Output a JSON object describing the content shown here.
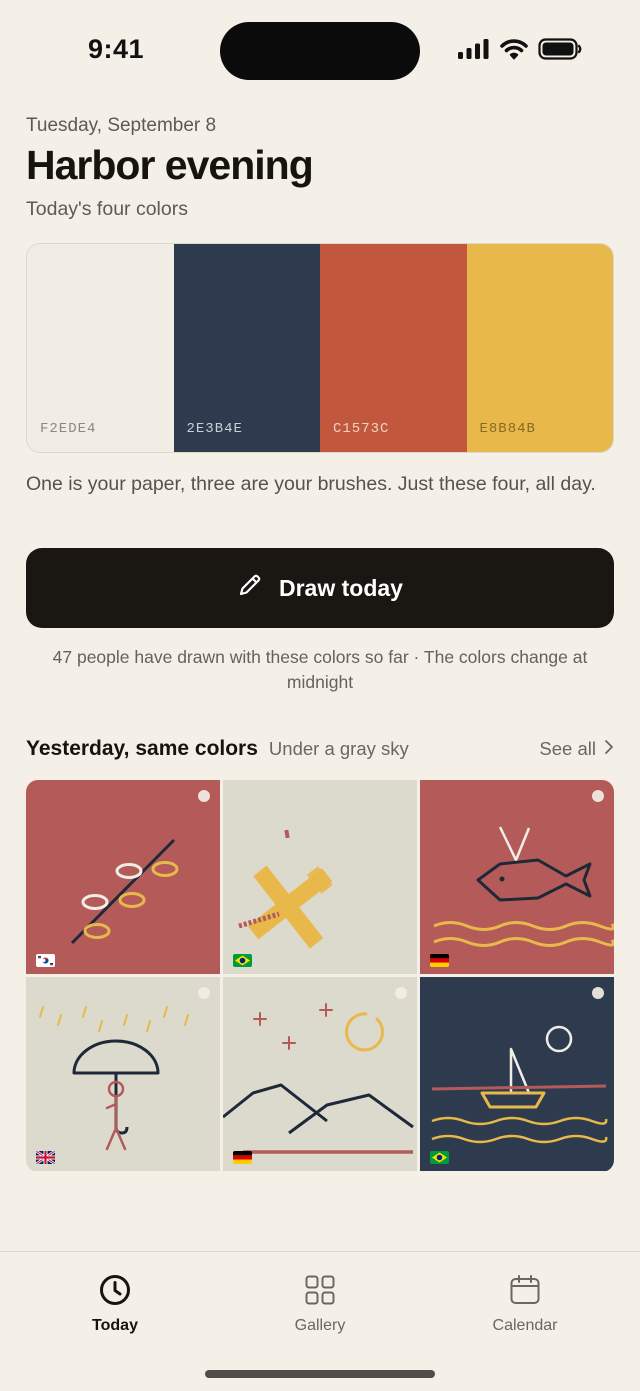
{
  "status": {
    "time": "9:41"
  },
  "header": {
    "date": "Tuesday, September 8",
    "title": "Harbor evening",
    "subtitle": "Today's four colors"
  },
  "palette": [
    {
      "hex": "F2EDE4",
      "color": "#F2EDE4",
      "text_color": "#8d887e"
    },
    {
      "hex": "2E3B4E",
      "color": "#2E3B4E",
      "text_color": "#c9cfd8"
    },
    {
      "hex": "C1573C",
      "color": "#C1573C",
      "text_color": "#f0d2c7"
    },
    {
      "hex": "E8B84B",
      "color": "#E8B84B",
      "text_color": "#8a6a20"
    }
  ],
  "blurb": "One is your paper, three are your brushes. Just these four, all day.",
  "draw_button": {
    "label": "Draw today",
    "icon": "pencil-icon"
  },
  "count_note": "47 people have drawn with these colors so far · The colors change at midnight",
  "yesterday": {
    "title": "Yesterday, same colors",
    "subtitle": "Under a gray sky",
    "see_all": "See all",
    "drawings": [
      {
        "subject": "rings-on-a-line",
        "flag": "south-korea",
        "background": "#B45B5A"
      },
      {
        "subject": "yellow-airplane",
        "flag": "brazil",
        "background": "#DCDACD"
      },
      {
        "subject": "whale",
        "flag": "germany",
        "background": "#B45B5A"
      },
      {
        "subject": "person-with-umbrella",
        "flag": "united-kingdom",
        "background": "#DCDACD"
      },
      {
        "subject": "hills-and-stars",
        "flag": "germany",
        "background": "#DCDACD"
      },
      {
        "subject": "sailboat",
        "flag": "brazil",
        "background": "#2E3B4E"
      }
    ]
  },
  "tabs": [
    {
      "label": "Today",
      "icon": "clock-icon",
      "active": true
    },
    {
      "label": "Gallery",
      "icon": "grid-icon",
      "active": false
    },
    {
      "label": "Calendar",
      "icon": "calendar-icon",
      "active": false
    }
  ]
}
